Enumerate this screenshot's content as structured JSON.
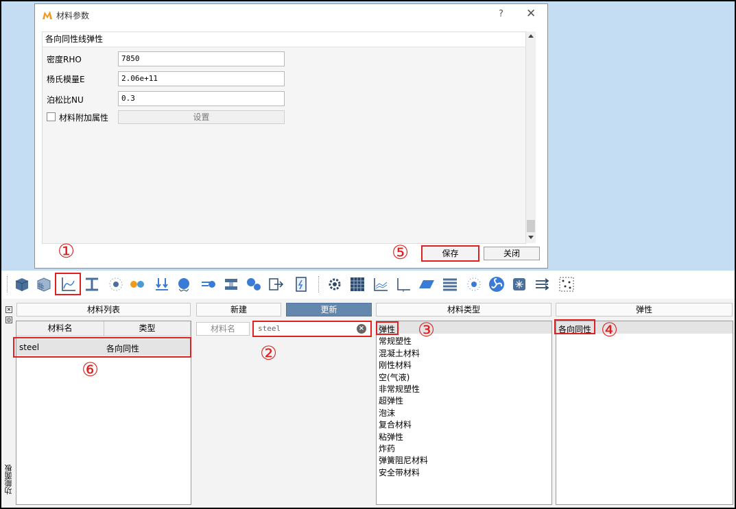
{
  "dialog": {
    "title": "材料参数",
    "help": "?",
    "close": "✕",
    "section": "各向同性线弹性",
    "fields": [
      {
        "label": "密度RHO",
        "value": "7850"
      },
      {
        "label": "杨氏模量E",
        "value": "2.06e+11"
      },
      {
        "label": "泊松比NU",
        "value": "0.3"
      }
    ],
    "extra_label": "材料附加属性",
    "extra_checked": false,
    "settings_button": "设置",
    "save_button": "保存",
    "close_button": "关闭"
  },
  "toolbar": {
    "icons": [
      "cube-icon",
      "grid-cube-icon",
      "curve-chart-icon",
      "i-beam-icon",
      "node-icon",
      "gears-icon",
      "down-arrows-icon",
      "sphere-icon",
      "arrow-dot-icon",
      "section-icon",
      "bubbles-icon",
      "export-icon",
      "calculator-icon",
      "settings-gear-icon",
      "table-grid-icon",
      "line-chart-icon",
      "axis-icon",
      "plane-icon",
      "list-icon",
      "dots-circle-icon",
      "fan-icon",
      "snow-cube-icon",
      "flow-arrows-icon",
      "dotted-box-icon"
    ]
  },
  "panel": {
    "vertical_label": "功能面板",
    "material_list": {
      "header": "材料列表",
      "columns": [
        "材料名",
        "类型"
      ],
      "rows": [
        {
          "name": "steel",
          "type": "各向同性"
        }
      ]
    },
    "new_button": "新建",
    "update_button": "更新",
    "name_placeholder": "材料名",
    "search_value": "steel",
    "material_type": {
      "header": "材料类型",
      "items": [
        "弹性",
        "常规塑性",
        "混凝土材料",
        "刚性材料",
        "空(气液)",
        "非常规塑性",
        "超弹性",
        "泡沫",
        "复合材料",
        "粘弹性",
        "炸药",
        "弹簧阻尼材料",
        "安全带材料"
      ],
      "selected": "弹性"
    },
    "elastic": {
      "header": "弹性",
      "items": [
        "各向同性"
      ],
      "selected": "各向同性"
    }
  },
  "markers": [
    "①",
    "②",
    "③",
    "④",
    "⑤",
    "⑥"
  ],
  "colors": {
    "highlight": "#e02020",
    "active_button": "#6487ad",
    "background": "#c4ddf3"
  }
}
